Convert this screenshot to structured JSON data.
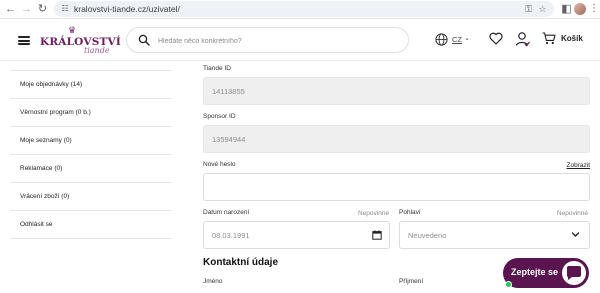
{
  "browser": {
    "url": "kralovstvi-tiande.cz/uzivatel/"
  },
  "header": {
    "logo_main": "KRÁLOVSTVÍ",
    "logo_sub": "tiande",
    "search_placeholder": "Hledáte něco konkrétního?",
    "language": "CZ",
    "cart_label": "Košík",
    "brand_color": "#6d1a62"
  },
  "sidebar": {
    "items": [
      {
        "label": "Moje objednávky (14)"
      },
      {
        "label": "Věrnostní program (0 b.)"
      },
      {
        "label": "Moje seznamy (0)"
      },
      {
        "label": "Reklamace (0)"
      },
      {
        "label": "Vrácení zboží (0)"
      },
      {
        "label": "Odhlásit se"
      }
    ]
  },
  "form": {
    "tiande_id": {
      "label": "Tiande ID",
      "value": "14113855"
    },
    "sponsor_id": {
      "label": "Sponsor ID",
      "value": "13594944"
    },
    "new_password": {
      "label": "Nové heslo",
      "show_link": "Zobrazit",
      "value": ""
    },
    "birth_date": {
      "label": "Datum narození",
      "optional": "Nepovinné",
      "value": "08.03.1991"
    },
    "gender": {
      "label": "Pohlaví",
      "optional": "Nepovinné",
      "value": "Neuvedeno"
    },
    "contact_section": "Kontaktní údaje",
    "first_name": {
      "label": "Jméno"
    },
    "last_name": {
      "label": "Příjmení"
    }
  },
  "chat": {
    "label": "Zeptejte se",
    "color": "#5a1450",
    "status_color": "#22c55e"
  }
}
